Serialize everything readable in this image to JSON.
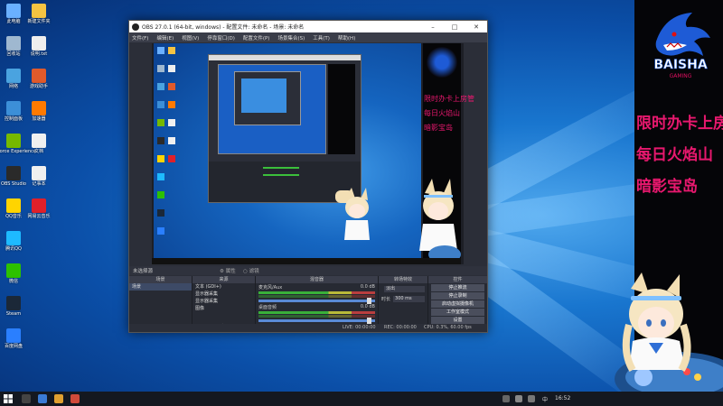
{
  "desktop": {
    "icons": [
      {
        "label": "此电脑",
        "color": "#6ab0ff"
      },
      {
        "label": "回收站",
        "color": "#9fb8d0"
      },
      {
        "label": "网络",
        "color": "#4aa3e0"
      },
      {
        "label": "控制面板",
        "color": "#3c8fd8"
      },
      {
        "label": "GeForce Experience",
        "color": "#76b900"
      },
      {
        "label": "OBS Studio",
        "color": "#2a2a2a"
      },
      {
        "label": "QQ音乐",
        "color": "#ffd400"
      },
      {
        "label": "腾讯QQ",
        "color": "#1ebaff"
      },
      {
        "label": "微信",
        "color": "#2dc100"
      },
      {
        "label": "Steam",
        "color": "#1b2838"
      },
      {
        "label": "百度网盘",
        "color": "#2a7fff"
      },
      {
        "label": "新建文件夹",
        "color": "#f5c342"
      },
      {
        "label": "说明.txt",
        "color": "#eeeeee"
      },
      {
        "label": "游戏助手",
        "color": "#e05a2b"
      },
      {
        "label": "加速器",
        "color": "#ff7a00"
      },
      {
        "label": "文档",
        "color": "#f0f0f0"
      },
      {
        "label": "记事本",
        "color": "#f0f0f0"
      },
      {
        "label": "网易云音乐",
        "color": "#e0202a"
      }
    ]
  },
  "panel": {
    "logo_text": "BAISHA",
    "logo_subtext": "GAMING",
    "lines": [
      "限时办卡上房管",
      "每日火焰山",
      "暗影宝岛"
    ]
  },
  "obs": {
    "title": "OBS 27.0.1 (64-bit, windows) - 配置文件: 未命名 - 场景: 未命名",
    "menu": [
      "文件(F)",
      "编辑(E)",
      "视图(V)",
      "停靠窗口(D)",
      "配置文件(P)",
      "场景集合(S)",
      "工具(T)",
      "帮助(H)"
    ],
    "preview_label": "未选择源",
    "properties_label": "属性",
    "filters_label": "滤镜",
    "docks": {
      "scenes": {
        "header": "场景",
        "items": [
          "场景"
        ]
      },
      "sources": {
        "header": "来源",
        "items": [
          "文本 (GDI+)",
          "显示器采集",
          "显示器采集",
          "图像"
        ]
      },
      "mixer": {
        "header": "混音器",
        "tracks": [
          {
            "name": "麦克风/Aux",
            "db": "0.0 dB"
          },
          {
            "name": "桌面音频",
            "db": "0.0 dB"
          }
        ]
      },
      "transitions": {
        "header": "转场特效",
        "type": "淡出",
        "duration_label": "时长",
        "duration": "300 ms"
      },
      "controls": {
        "header": "控件",
        "buttons": [
          "停止推流",
          "停止录制",
          "启动虚拟摄像机",
          "工作室模式",
          "设置",
          "退出"
        ]
      }
    },
    "status": {
      "live": "LIVE: 00:00:00",
      "rec": "REC: 00:00:00",
      "cpu": "CPU: 0.3%, 60.00 fps"
    }
  },
  "taskbar": {
    "time": "16:52",
    "lang": "中"
  }
}
